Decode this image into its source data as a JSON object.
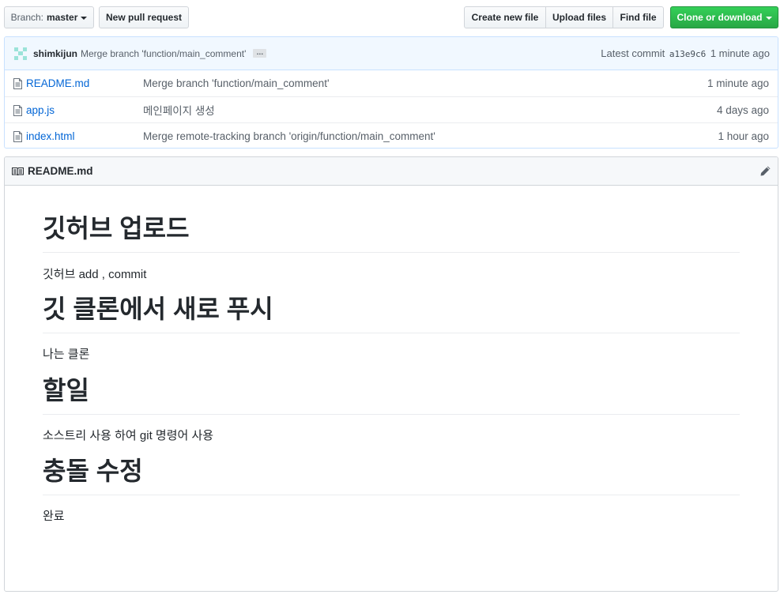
{
  "toolbar": {
    "branch_label": "Branch:",
    "branch_name": "master",
    "new_pull_request": "New pull request",
    "create_new_file": "Create new file",
    "upload_files": "Upload files",
    "find_file": "Find file",
    "clone_or_download": "Clone or download",
    "clone_color": "#28a745"
  },
  "commit": {
    "author": "shimkijun",
    "message": "Merge branch 'function/main_comment'",
    "ellipsis": "…",
    "latest_label": "Latest commit",
    "sha": "a13e9c6",
    "age": "1 minute ago"
  },
  "files": [
    {
      "icon": "file-icon",
      "name": "README.md",
      "message": "Merge branch 'function/main_comment'",
      "age": "1 minute ago"
    },
    {
      "icon": "file-icon",
      "name": "app.js",
      "message": "메인페이지 생성",
      "age": "4 days ago"
    },
    {
      "icon": "file-icon",
      "name": "index.html",
      "message": "Merge remote-tracking branch 'origin/function/main_comment'",
      "age": "1 hour ago"
    }
  ],
  "readme": {
    "title": "README.md",
    "icons": {
      "header": "book-icon",
      "edit": "pencil-icon"
    },
    "sections": [
      {
        "heading": "깃허브 업로드",
        "text": "깃허브 add , commit"
      },
      {
        "heading": "깃 클론에서 새로 푸시",
        "text": "나는 클론"
      },
      {
        "heading": "할일",
        "text": "소스트리 사용 하여 git 명령어 사용"
      },
      {
        "heading": "충돌 수정",
        "text": "완료"
      }
    ]
  }
}
